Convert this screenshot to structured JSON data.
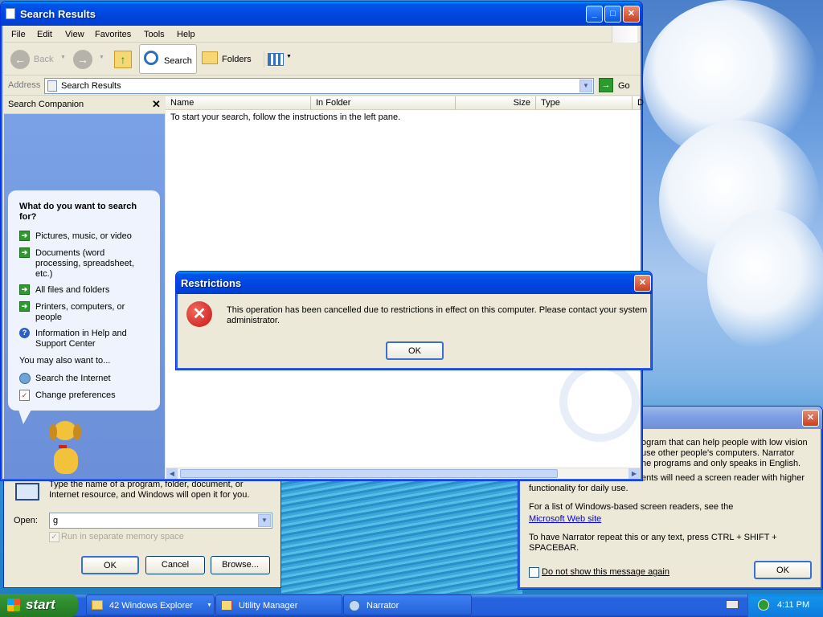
{
  "search_window": {
    "title": "Search Results",
    "menu": [
      "File",
      "Edit",
      "View",
      "Favorites",
      "Tools",
      "Help"
    ],
    "toolbar": {
      "back": "Back",
      "search": "Search",
      "folders": "Folders"
    },
    "address": {
      "label": "Address",
      "value": "Search Results",
      "go": "Go"
    },
    "companion": {
      "title": "Search Companion",
      "question": "What do you want to search for?",
      "options": [
        "Pictures, music, or video",
        "Documents (word processing, spreadsheet, etc.)",
        "All files and folders",
        "Printers, computers, or people",
        "Information in Help and Support Center"
      ],
      "also": "You may also want to...",
      "extras": [
        "Search the Internet",
        "Change preferences"
      ]
    },
    "columns": [
      "Name",
      "In Folder",
      "Size",
      "Type",
      "D"
    ],
    "empty_message": "To start your search, follow the instructions in the left pane."
  },
  "restrictions_dialog": {
    "title": "Restrictions",
    "message": "This operation has been cancelled due to restrictions in effect on this computer. Please contact your system administrator.",
    "ok": "OK"
  },
  "run_dialog": {
    "desc": "Type the name of a program, folder, document, or Internet resource, and Windows will open it for you.",
    "open_label": "Open:",
    "open_value": "g",
    "separate_memory": "Run in separate memory space",
    "ok": "OK",
    "cancel": "Cancel",
    "browse": "Browse..."
  },
  "narrator_dialog": {
    "line1": "ogram that can help people with low vision",
    "line2": "use other people's computers. Narrator",
    "line3": "he programs and only speaks in English.",
    "line4": "ents will need a screen reader with higher",
    "line5": "functionality for daily use.",
    "para2": "For a list of Windows-based screen readers, see the",
    "link": "Microsoft Web site",
    "para3": "To have Narrator repeat this or any text, press CTRL + SHIFT + SPACEBAR.",
    "checkbox": "Do not show this message again",
    "ok": "OK"
  },
  "taskbar": {
    "start": "start",
    "items": [
      "42 Windows Explorer",
      "Utility Manager",
      "Narrator"
    ],
    "clock": "4:11 PM"
  }
}
